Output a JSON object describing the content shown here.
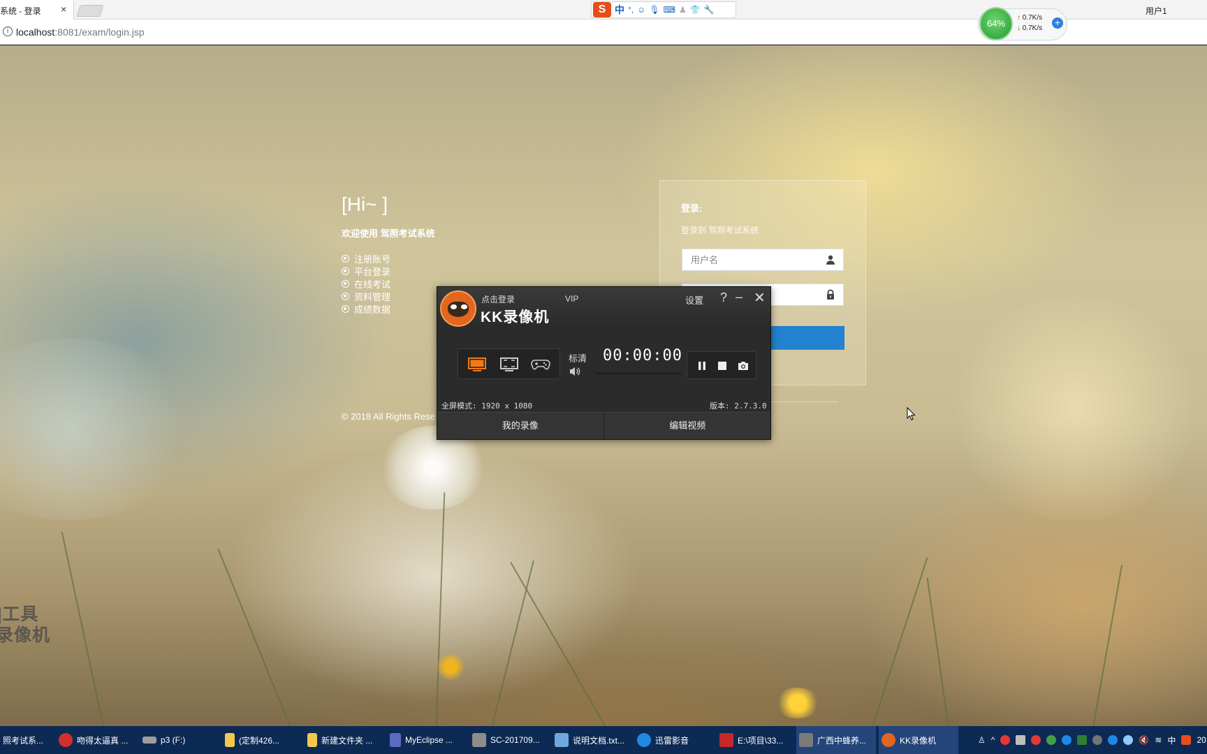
{
  "browser": {
    "tab_title": "系统 - 登录",
    "tab_close": "×",
    "url_host": "localhost",
    "url_rest": ":8081/exam/login.jsp",
    "user_label": "用户1"
  },
  "ime": {
    "logo": "S",
    "lang": "中",
    "icons": [
      "dot-icon",
      "emoji-icon",
      "mic-icon",
      "keyboard-icon",
      "user-icon",
      "shirt-icon",
      "wrench-icon"
    ]
  },
  "net_widget": {
    "percent": "64%",
    "up": "0.7K/s",
    "down": "0.7K/s"
  },
  "page": {
    "hi": "[Hi~ ]",
    "welcome": "欢迎使用 驾照考试系统",
    "features": [
      "注册账号",
      "平台登录",
      "在线考试",
      "资料管理",
      "成绩数据"
    ],
    "copyright": "© 2018 All Rights Rese",
    "login_title": "登录:",
    "login_subtitle": "登录到 驾照考试系统",
    "username_placeholder": "用户名",
    "password_placeholder": "",
    "login_button": ""
  },
  "watermark": {
    "line1": "]工具",
    "line2": "录像机"
  },
  "kk": {
    "login": "点击登录",
    "vip": "VIP",
    "brand": "KK录像机",
    "settings": "设置",
    "help": "?",
    "minimize": "–",
    "close": "✕",
    "quality": "标清",
    "time": "00:00:00",
    "mode_text": "全屏模式: 1920 x 1080",
    "version": "版本: 2.7.3.0",
    "tabs": [
      "我的录像",
      "编辑视频"
    ]
  },
  "taskbar": {
    "items": [
      {
        "label": "照考试系...",
        "color": "#3c6fb0"
      },
      {
        "label": "吻得太逼真 ...",
        "color": "#d32f2f"
      },
      {
        "label": "p3 (F:)",
        "color": "#9e9e9e"
      },
      {
        "label": "(定制426...",
        "color": "#f2c94c"
      },
      {
        "label": "新建文件夹 ...",
        "color": "#f2c94c"
      },
      {
        "label": "MyEclipse ...",
        "color": "#5c6bc0"
      },
      {
        "label": "SC-201709...",
        "color": "#8d8d8d"
      },
      {
        "label": "说明文档.txt...",
        "color": "#6fa8dc"
      },
      {
        "label": "迅雷影音",
        "color": "#1e88e5"
      },
      {
        "label": "E:\\项目\\33...",
        "color": "#c62828"
      },
      {
        "label": "广西中蜂养...",
        "color": "#7b7b7b"
      },
      {
        "label": "KK录像机",
        "color": "#e2661d"
      }
    ],
    "ime": "中",
    "clock_fragment": "20"
  }
}
